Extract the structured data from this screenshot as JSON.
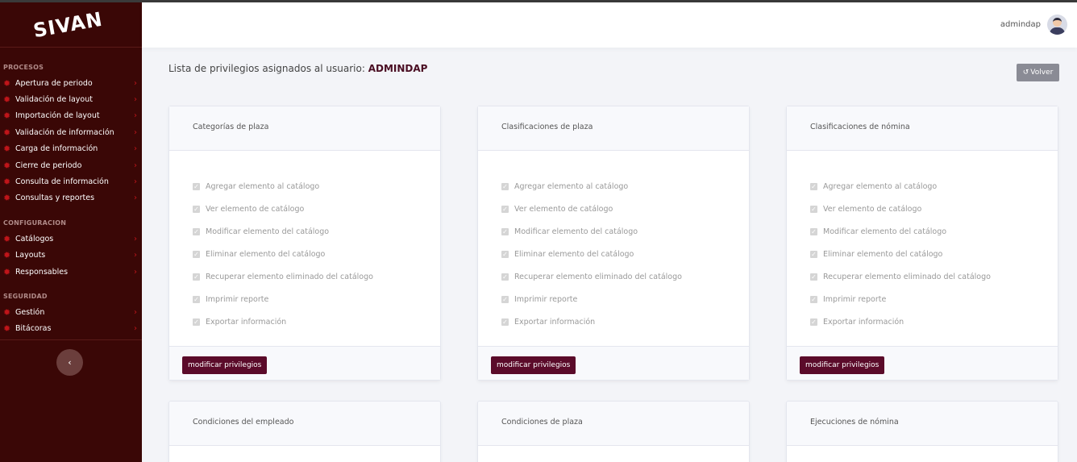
{
  "logo": "SIVAN",
  "header": {
    "username": "admindap"
  },
  "page": {
    "title_prefix": "Lista de privilegios asignados al usuario:",
    "title_user": "ADMINDAP",
    "back_label": "Volver"
  },
  "sidebar": {
    "sections": [
      {
        "title": "PROCESOS",
        "items": [
          "Apertura de periodo",
          "Validación de layout",
          "Importación de layout",
          "Validación de información",
          "Carga de información",
          "Cierre de periodo",
          "Consulta de información",
          "Consultas y reportes"
        ]
      },
      {
        "title": "CONFIGURACION",
        "items": [
          "Catálogos",
          "Layouts",
          "Responsables"
        ]
      },
      {
        "title": "SEGURIDAD",
        "items": [
          "Gestión",
          "Bitácoras"
        ]
      }
    ]
  },
  "permissions": [
    "Agregar elemento al catálogo",
    "Ver elemento de catálogo",
    "Modificar elemento del catálogo",
    "Eliminar elemento del catálogo",
    "Recuperar elemento eliminado del catálogo",
    "Imprimir reporte",
    "Exportar información"
  ],
  "modify_label": "modificar privilegios",
  "cards": [
    {
      "title": "Categorías de plaza"
    },
    {
      "title": "Clasificaciones de plaza"
    },
    {
      "title": "Clasificaciones de nómina"
    },
    {
      "title": "Condiciones del empleado"
    },
    {
      "title": "Condiciones de plaza"
    },
    {
      "title": "Ejecuciones de nómina"
    }
  ],
  "colors": {
    "sidebar_bg": "#3a0706",
    "accent": "#5b0b2a",
    "icon_red": "#c0151a"
  }
}
